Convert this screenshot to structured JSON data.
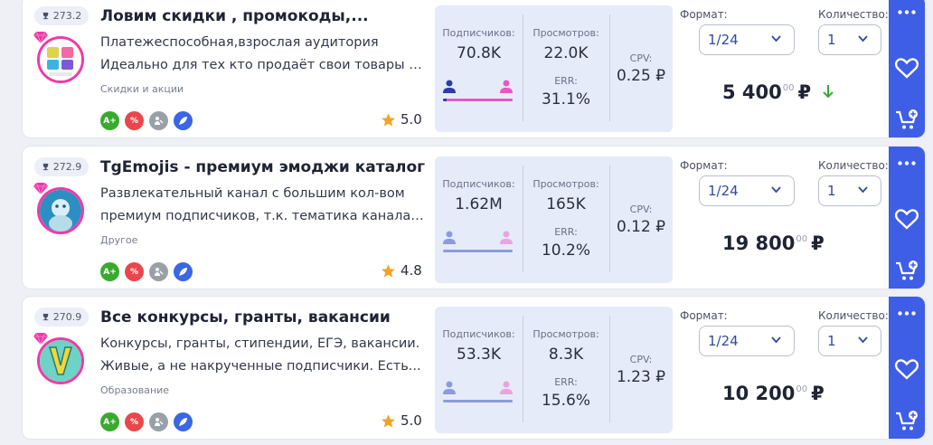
{
  "labels": {
    "subscribers": "Подписчиков:",
    "views": "Просмотров:",
    "err": "ERR:",
    "cpv": "CPV:",
    "format": "Формат:",
    "quantity": "Количество:"
  },
  "colors": {
    "accent": "#3e5ee6",
    "avatar_ring": "#f03aa6",
    "male": "#2c3da8",
    "female": "#e45bc0",
    "stats_bg": "#e6ebf9",
    "price_down": "#3aaa2f"
  },
  "icons": {
    "rating": "trophy-icon",
    "premium": "diamond-icon",
    "star": "star-icon",
    "more": "more-dots-icon",
    "favorite": "heart-icon",
    "add_to_cart": "cart-plus-icon",
    "price_down": "arrow-down-icon"
  },
  "channels": [
    {
      "rating": "273.2",
      "title": "Ловим скидки , промокоды,...",
      "desc_line1": "Платежеспособная,взрослая аудитория",
      "desc_line2": "Идеально для тех кто продаёт свои товары на...",
      "category": "Скидки и акции",
      "badge_a": "A+",
      "badge_b": "%",
      "score": "5.0",
      "subscribers": "70.8K",
      "views": "22.0K",
      "err": "31.1%",
      "cpv": "0.25 ₽",
      "male_share": 0.05,
      "female_share": 0.95,
      "format": "1/24",
      "quantity": "1",
      "price_main": "5 400",
      "price_cents": "00",
      "currency": "₽",
      "price_trend": "down"
    },
    {
      "rating": "272.9",
      "title": "TgEmojis - премиум эмоджи каталог",
      "desc_line1": "Развлекательный канал с большим кол-вом",
      "desc_line2": "премиум подписчиков, т.к. тематика канала -...",
      "category": "Другое",
      "badge_a": "A+",
      "badge_b": "%",
      "score": "4.8",
      "subscribers": "1.62M",
      "views": "165K",
      "err": "10.2%",
      "cpv": "0.12 ₽",
      "male_share": 0.5,
      "female_share": 0.5,
      "format": "1/24",
      "quantity": "1",
      "price_main": "19 800",
      "price_cents": "00",
      "currency": "₽",
      "price_trend": "none"
    },
    {
      "rating": "270.9",
      "title": "Все конкурсы, гранты, вакансии",
      "desc_line1": "Конкурсы, гранты, стипендии, ЕГЭ, вакансии.",
      "desc_line2": "Живые, а не накрученные подписчики. Есть...",
      "category": "Образование",
      "badge_a": "A+",
      "badge_b": "%",
      "score": "5.0",
      "subscribers": "53.3K",
      "views": "8.3K",
      "err": "15.6%",
      "cpv": "1.23 ₽",
      "male_share": 0.5,
      "female_share": 0.5,
      "format": "1/24",
      "quantity": "1",
      "price_main": "10 200",
      "price_cents": "00",
      "currency": "₽",
      "price_trend": "none"
    }
  ]
}
